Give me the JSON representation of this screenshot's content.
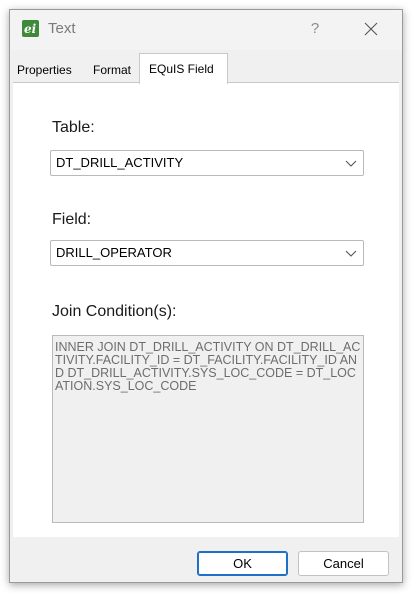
{
  "window": {
    "title": "Text",
    "help": "?"
  },
  "tabs": [
    {
      "label": "Properties"
    },
    {
      "label": "Format"
    },
    {
      "label": "EQuIS Field"
    }
  ],
  "panel": {
    "table_label": "Table:",
    "table_value": "DT_DRILL_ACTIVITY",
    "field_label": "Field:",
    "field_value": "DRILL_OPERATOR",
    "join_label": "Join Condition(s):",
    "join_text": "INNER JOIN DT_DRILL_ACTIVITY ON DT_DRILL_ACTIVITY.FACILITY_ID = DT_FACILITY.FACILITY_ID AND DT_DRILL_ACTIVITY.SYS_LOC_CODE = DT_LOCATION.SYS_LOC_CODE"
  },
  "buttons": {
    "ok": "OK",
    "cancel": "Cancel"
  },
  "colors": {
    "accent": "#1f6fc6",
    "app_icon": "#3f8a3a"
  },
  "icons": {
    "app": "equis-app-icon",
    "close": "close-icon",
    "dropdown": "chevron-down-icon"
  }
}
